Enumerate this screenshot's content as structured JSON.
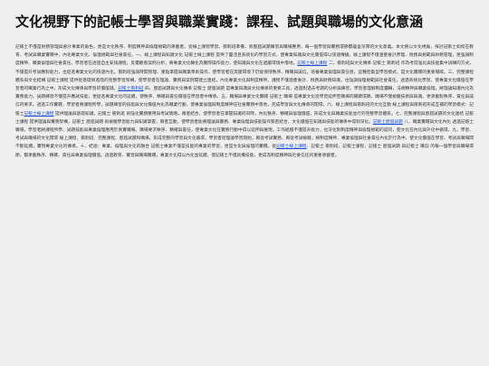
{
  "article": {
    "title": "文化視野下的記帳士學習與職業實踐：課程、試題與職場的文化意涵",
    "segments": [
      {
        "text": "記帳士不僅是財務管理與會計事業的角色，更是文化秩序、制度精神與倫理規範的承載者。從線上課程學習、衝刺班準備，到歷屆試題練習與職場應用，每一個學習與實務環節都蘊含深厚的文化意義。本文將以文化視角，探討記帳士如何在教育、考試與職業實踐中，內化專業文化、倫理規範與社會責任。一、線上課程與知識文化 記帳士線上課程 提供了靈活且系統化的學習方式，使專業知識與文化價值得以快速傳播。線上課程不僅涵蓋會計原理、稅務與規範與財務管理，更強調制度精神、職業倫理與社會責任。學習者在透過自主安排課程，反覆觀看案例分析，將專業文化轉化為實際操作能力，使知識與文化在遞屬環境中落地。"
      },
      {
        "text": "記帳士線上課程",
        "link": true
      },
      {
        "text": " 二、衝刺班與文化傳承 記帳士 衝刺班 作為考前強化與技能集中訓練的方式，不僅提升考試應對能力，也促進專業文化的快速內化。衝刺班強調時間管理、重點掌握與職業準則操作，使學習者在高壓環境下仍能保持秩序、精確與誠信。培養專業倫理與責任感，這種密集型學習模式，是文化實踐的重要場域。三、完整課程體系與文化結構 記帳士課程 提供從基礎到進階的完整學習架構，使學習者在理論、實務與案例間建立連結，內化專業文化與制度精神。課程不僅涵蓋會計、稅務與財務知識，也強調倫理規範與社會責任，透過系統化學習，使專業文化價值在學習者的職業行為之中。形成文化傳承與學習的價值鏈。"
      },
      {
        "text": "記帳士衝刺班",
        "link": true
      },
      {
        "text": " 四、歷屆試題與文化傳承 記帳士 歷屆試題 是專業知識與文化傳承的重要工具，透過對過去考題的分析與練習，學習者理解制度邏輯，法規精神與職業倫理，將理論知識內化為實務能力。試題練習不僅提升應試技能，更促進專業文化的延續，使秩序、精確與責任價值在學習者中傳承。五、職場與專業文化實踐 記帳士 職場 是專業文化從學習延伸至職場的關鍵環節。職場不僅檢驗技術與知識，更承載對秩序、責任與誠信的要求。透過工作實踐，學習者將課程所學，試題練習的技能與文化價值內化為職業行動，使專業倫理與制度精神在社會實務中落地，完成學習與文化傳承的閉環。六、線上課程與衝刺班的文化互動 線上課程與衝刺班形成互補的學習模式：記帳士"
      },
      {
        "text": "記帳士線上課程",
        "link": true
      },
      {
        "text": " 提供理論與基礎知識，記帳士 衝刺班 則強化實務應用與考試策略，兩者結合，使學習者在掌握知識的同時，內化秩序、精確與倫理價值，形成文化與職業技能並行的完整學習體系。七、完整課程與歷屆試題的文化連結 記帳士課程 提供理論與實務架構，記帳士 歷屆試題 則檢驗學習能力與知識掌握，兩者互動，使學習者能將理論與實務、專業倫理與技能操作緊密結合，文化價值在知識與技能的傳承中得到深化。"
      },
      {
        "text": "記帳士歷屆試題",
        "link": true
      },
      {
        "text": " 八、職業實踐與文化內化 透過記帳士職場，學習者將課程所學、試題技能與專業倫理應用於真實職場。職場要求秩序、精確與責任，使專業文化在實務行動中得以延伸與展現，工作經驗不僅提升能力，也深化對制度精神與倫理規範的認同，使文化在內化與外化中循環。九、學習、考試與職場的文化閉環 線上課程、衝刺班、完整課程、歷屆試題和職場，形成完整的學習與文化循環，學習者從理論學習開始，再從考試實務、再從考試檢驗，將制度精神、專業倫理與社會責任內化於行為中，使文化價值在學習、考試與職場間不斷延續，實現專業文化的傳承。十、結語：專業、倫理與文化的融合 記帳士專業不僅是技能的專業的學習，更是文化與倫理的實踐。從"
      },
      {
        "text": "記帳士線上課程",
        "link": true
      },
      {
        "text": "、記帳士 衝刺班、記帳士課程，記帳士 歷屆試題 與記帳士 職涯 的每一個學習與職場環節，都承載秩序、精確、責任與專業倫理價值。透過教育、實習與職場實踐，專業文化得以內化並延續，使記帳士不僅具備技能，更成為制度精神與社會信任的重要承載者。"
      }
    ]
  }
}
